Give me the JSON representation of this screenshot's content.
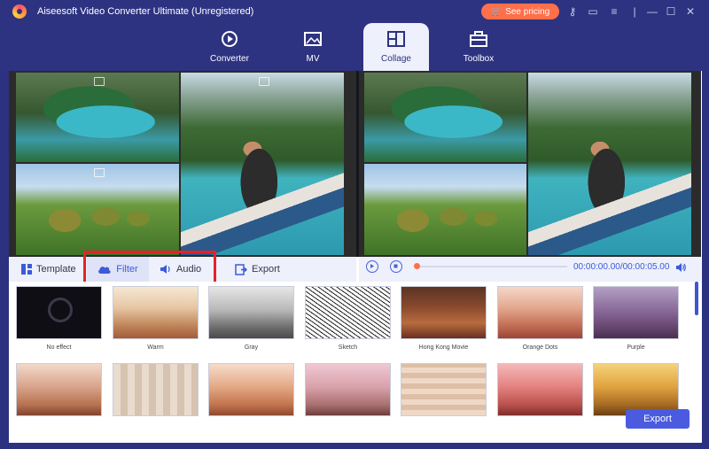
{
  "app": {
    "title": "Aiseesoft Video Converter Ultimate (Unregistered)",
    "pricing_label": "See pricing"
  },
  "tabs": [
    {
      "label": "Converter"
    },
    {
      "label": "MV"
    },
    {
      "label": "Collage"
    },
    {
      "label": "Toolbox"
    }
  ],
  "toolbar": {
    "template_label": "Template",
    "filter_label": "Filter",
    "audio_label": "Audio",
    "export_label": "Export"
  },
  "player": {
    "time": "00:00:00.00/00:00:05.00"
  },
  "filters": [
    {
      "name": "No effect"
    },
    {
      "name": "Warm"
    },
    {
      "name": "Gray"
    },
    {
      "name": "Sketch"
    },
    {
      "name": "Hong Kong Movie"
    },
    {
      "name": "Orange Dots"
    },
    {
      "name": "Purple"
    }
  ],
  "export_button": "Export",
  "colors": {
    "accent": "#4a5be0",
    "pricing": "#ff6f4a",
    "titlebar": "#2d3381",
    "highlight": "#e4222d"
  }
}
